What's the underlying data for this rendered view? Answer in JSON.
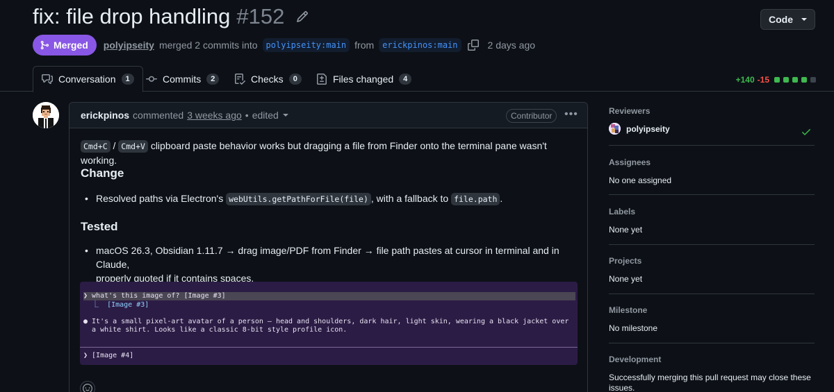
{
  "pr": {
    "title": "fix: file drop handling",
    "number": "#152",
    "state_label": "Merged",
    "merger": "polyipseity",
    "merged_text": "merged 2 commits into",
    "base_branch": "polyipseity:main",
    "from_text": "from",
    "head_branch": "erickpinos:main",
    "time": "2 days ago"
  },
  "code_button": {
    "label": "Code"
  },
  "tabs": [
    {
      "label": "Conversation",
      "count": "1",
      "icon": "comment-discussion-icon"
    },
    {
      "label": "Commits",
      "count": "2",
      "icon": "git-commit-icon"
    },
    {
      "label": "Checks",
      "count": "0",
      "icon": "checklist-icon"
    },
    {
      "label": "Files changed",
      "count": "4",
      "icon": "file-diff-icon"
    }
  ],
  "diffstat": {
    "additions": "+140",
    "deletions": "-15",
    "colors": [
      "#3fb950",
      "#3fb950",
      "#3fb950",
      "#3fb950",
      "#3d444d"
    ]
  },
  "comment": {
    "author": "erickpinos",
    "action": "commented",
    "time": "3 weeks ago",
    "separator": "•",
    "edited": "edited",
    "badge": "Contributor",
    "intro": {
      "kbd1": "Cmd+C",
      "slash": "/",
      "kbd2": "Cmd+V",
      "text": "clipboard paste behavior works but dragging a file from Finder onto the terminal pane wasn't working."
    },
    "change_heading": "Change",
    "change_item": {
      "pre": "Resolved paths via Electron's",
      "code1": "webUtils.getPathForFile(file)",
      "mid": ", with a fallback to",
      "code2": "file.path",
      "post": "."
    },
    "tested_heading": "Tested",
    "tested_item_line1": "macOS 26.3, Obsidian 1.11.7 → drag image/PDF from Finder → file path pastes at cursor in terminal and in Claude,",
    "tested_item_line2": "properly quoted if it contains spaces.",
    "terminal": {
      "prompt": "❯ what's this image of? [Image #3]",
      "attachment": "  ⎿  [Image #3]",
      "response_line1": "● It's a small pixel-art avatar of a person — head and shoulders, dark hair, light skin, wearing a black jacket over",
      "response_line2": "  a white shirt. Looks like a classic 8-bit style profile icon.",
      "input": "❯ [Image #4]"
    }
  },
  "sidebar": {
    "reviewers_title": "Reviewers",
    "reviewer_name": "polyipseity",
    "assignees_title": "Assignees",
    "assignees_value": "No one assigned",
    "labels_title": "Labels",
    "labels_value": "None yet",
    "projects_title": "Projects",
    "projects_value": "None yet",
    "milestone_title": "Milestone",
    "milestone_value": "No milestone",
    "development_title": "Development",
    "development_value": "Successfully merging this pull request may close these issues."
  }
}
